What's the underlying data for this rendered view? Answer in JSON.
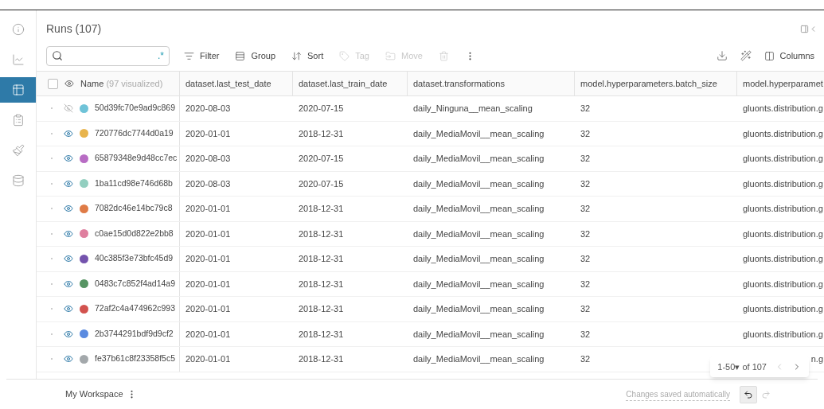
{
  "title": "Runs (107)",
  "toolbar": [
    {
      "kind": "filter",
      "label": "Filter",
      "disabled": false
    },
    {
      "kind": "group",
      "label": "Group",
      "disabled": false
    },
    {
      "kind": "sort",
      "label": "Sort",
      "disabled": false
    },
    {
      "kind": "tag",
      "label": "Tag",
      "disabled": true
    },
    {
      "kind": "move",
      "label": "Move",
      "disabled": true
    }
  ],
  "search": {
    "regex_toggle": ".*"
  },
  "select_all": {
    "checked": false
  },
  "columns_button": "Columns",
  "name_header": {
    "label": "Name",
    "note": "(97 visualized)"
  },
  "columns": [
    "dataset.last_test_date",
    "dataset.last_train_date",
    "dataset.transformations",
    "model.hyperparameters.batch_size",
    "model.hyperparamet"
  ],
  "rows": [
    {
      "name": "50d39fc70e9ad9c869",
      "color": "#6fc3d8",
      "visible": false,
      "cells": [
        "2020-08-03",
        "2020-07-15",
        "daily_Ninguna__mean_scaling",
        "32",
        "gluonts.distribution.g"
      ]
    },
    {
      "name": "720776dc7744d0a19",
      "color": "#e8b44c",
      "visible": true,
      "cells": [
        "2020-01-01",
        "2018-12-31",
        "daily_MediaMovil__mean_scaling",
        "32",
        "gluonts.distribution.g"
      ]
    },
    {
      "name": "65879348e9d48cc7ec",
      "color": "#b86cc4",
      "visible": true,
      "cells": [
        "2020-08-03",
        "2020-07-15",
        "daily_MediaMovil__mean_scaling",
        "32",
        "gluonts.distribution.g"
      ]
    },
    {
      "name": "1ba11cd98e746d68b",
      "color": "#93cfc0",
      "visible": true,
      "cells": [
        "2020-08-03",
        "2020-07-15",
        "daily_MediaMovil__mean_scaling",
        "32",
        "gluonts.distribution.g"
      ]
    },
    {
      "name": "7082dc46e14bc79c8",
      "color": "#df7b46",
      "visible": true,
      "cells": [
        "2020-01-01",
        "2018-12-31",
        "daily_MediaMovil__mean_scaling",
        "32",
        "gluonts.distribution.g"
      ]
    },
    {
      "name": "c0ae15d0d822e2bb8",
      "color": "#df7f9f",
      "visible": true,
      "cells": [
        "2020-01-01",
        "2018-12-31",
        "daily_MediaMovil__mean_scaling",
        "32",
        "gluonts.distribution.g"
      ]
    },
    {
      "name": "40c385f3e73bfc45d9",
      "color": "#7453ad",
      "visible": true,
      "cells": [
        "2020-01-01",
        "2018-12-31",
        "daily_MediaMovil__mean_scaling",
        "32",
        "gluonts.distribution.g"
      ]
    },
    {
      "name": "0483c7c852f4ad14a9",
      "color": "#579463",
      "visible": true,
      "cells": [
        "2020-01-01",
        "2018-12-31",
        "daily_MediaMovil__mean_scaling",
        "32",
        "gluonts.distribution.g"
      ]
    },
    {
      "name": "72af2c4a474962c993",
      "color": "#d2524e",
      "visible": true,
      "cells": [
        "2020-01-01",
        "2018-12-31",
        "daily_MediaMovil__mean_scaling",
        "32",
        "gluonts.distribution.g"
      ]
    },
    {
      "name": "2b3744291bdf9d9cf2",
      "color": "#5b8be0",
      "visible": true,
      "cells": [
        "2020-01-01",
        "2018-12-31",
        "daily_MediaMovil__mean_scaling",
        "32",
        "gluonts.distribution.g"
      ]
    },
    {
      "name": "fe37b61c8f23358f5c5",
      "color": "#a3a8ab",
      "visible": true,
      "last_cell_covered": true,
      "cells": [
        "2020-01-01",
        "2018-12-31",
        "daily_MediaMovil__mean_scaling",
        "32",
        "n.g"
      ]
    }
  ],
  "pagination": {
    "range": "1-50",
    "caret": "▾",
    "total": "of 107"
  },
  "footer": {
    "workspace": "My Workspace",
    "saved": "Changes saved automatically"
  },
  "sidebar": [
    {
      "kind": "info",
      "selected": false
    },
    {
      "kind": "chart",
      "selected": false
    },
    {
      "kind": "table",
      "selected": true
    },
    {
      "kind": "clipboard",
      "selected": false
    },
    {
      "kind": "brush",
      "selected": false
    },
    {
      "kind": "database",
      "selected": false
    }
  ]
}
